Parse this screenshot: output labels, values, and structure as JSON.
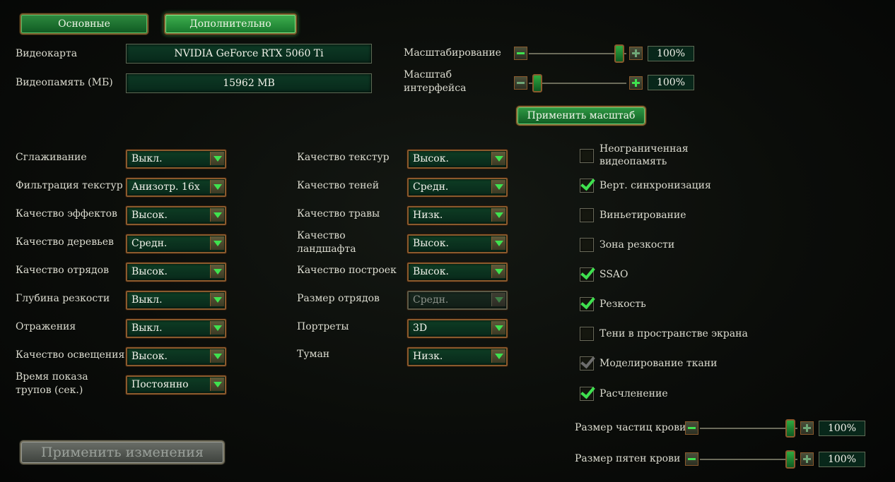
{
  "tabs": [
    {
      "label": "Основные"
    },
    {
      "label": "Дополнительно"
    }
  ],
  "gpu": {
    "label": "Видеокарта",
    "value": "NVIDIA GeForce RTX 5060 Ti",
    "mem_label": "Видеопамять (МБ)",
    "mem_value": "15962 MB"
  },
  "scaling": {
    "label": "Масштабирование",
    "value": "100%",
    "ui_label_line1": "Масштаб",
    "ui_label_line2": "интерфейса",
    "ui_value": "100%",
    "apply_label": "Применить масштаб"
  },
  "left_settings": [
    {
      "label": "Сглаживание",
      "value": "Выкл."
    },
    {
      "label": "Фильтрация текстур",
      "value": "Анизотр. 16x"
    },
    {
      "label": "Качество эффектов",
      "value": "Высок."
    },
    {
      "label": "Качество деревьев",
      "value": "Средн."
    },
    {
      "label": "Качество отрядов",
      "value": "Высок."
    },
    {
      "label": "Глубина резкости",
      "value": "Выкл."
    },
    {
      "label": "Отражения",
      "value": "Выкл."
    },
    {
      "label": "Качество освещения",
      "value": "Высок."
    }
  ],
  "corpse": {
    "label_line1": "Время показа",
    "label_line2": "трупов (сек.)",
    "value": "Постоянно"
  },
  "mid_settings": [
    {
      "label": "Качество текстур",
      "value": "Высок."
    },
    {
      "label": "Качество теней",
      "value": "Средн."
    },
    {
      "label": "Качество травы",
      "value": "Низк."
    },
    {
      "label": "Качество ландшафта",
      "value": "Высок."
    },
    {
      "label": "Качество построек",
      "value": "Высок."
    },
    {
      "label": "Размер отрядов",
      "value": "Средн."
    },
    {
      "label": "Портреты",
      "value": "3D"
    },
    {
      "label": "Туман",
      "value": "Низк."
    }
  ],
  "checkboxes": [
    {
      "label": "Неограниченная видеопамять",
      "checked": false
    },
    {
      "label": "Верт. синхронизация",
      "checked": true
    },
    {
      "label": "Виньетирование",
      "checked": false
    },
    {
      "label": "Зона резкости",
      "checked": false
    },
    {
      "label": "SSAO",
      "checked": true
    },
    {
      "label": "Резкость",
      "checked": true
    },
    {
      "label": "Тени в пространстве экрана",
      "checked": false
    },
    {
      "label": "Моделирование ткани",
      "checked": true
    },
    {
      "label": "Расчленение",
      "checked": true
    }
  ],
  "blood": {
    "particles_label": "Размер частиц крови",
    "particles_value": "100%",
    "stains_label": "Размер пятен крови",
    "stains_value": "100%"
  },
  "apply_changes_label": "Применить изменения"
}
